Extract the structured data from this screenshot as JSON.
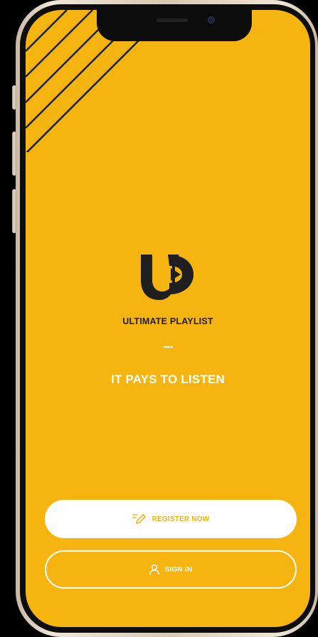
{
  "app": {
    "brand_name": "ULTIMATE PLAYLIST",
    "tagline": "IT PAYS TO LISTEN",
    "logo_icon": "up-logo-icon"
  },
  "actions": {
    "register_label": "REGISTER NOW",
    "register_icon": "pencil-edit-icon",
    "signin_label": "SIGN IN",
    "signin_icon": "user-icon"
  },
  "colors": {
    "background": "#f6b410",
    "logo": "#1f1f1f",
    "button_fill": "#ffffff",
    "accent_text": "#f6b410"
  }
}
